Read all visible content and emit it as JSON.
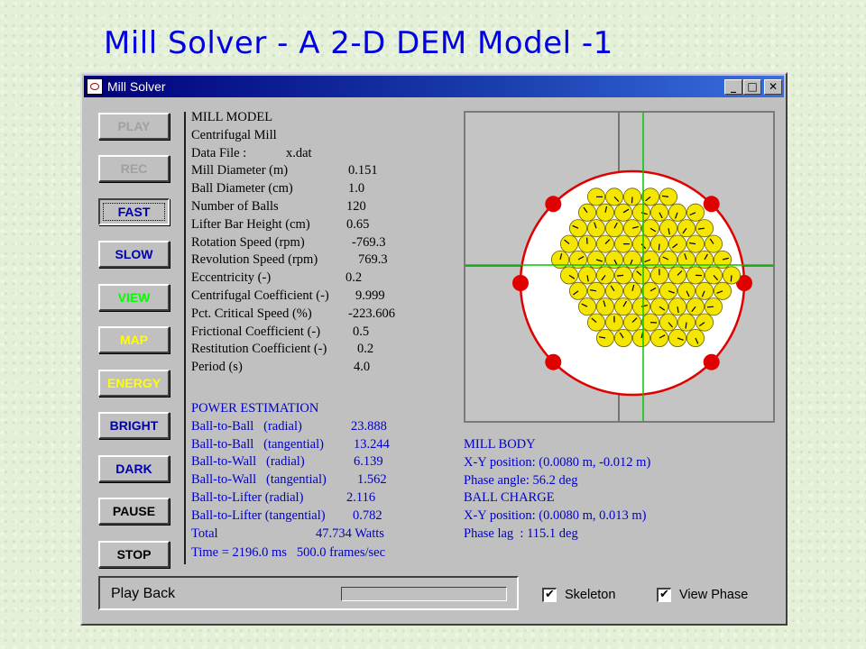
{
  "slide_title": "Mill Solver - A 2-D DEM Model -1",
  "window": {
    "title": "Mill Solver",
    "controls": {
      "minimize": "_",
      "maximize": "□",
      "close": "✕"
    }
  },
  "buttons": [
    {
      "label": "PLAY",
      "color": "#a0a0a0",
      "state": "disabled"
    },
    {
      "label": "REC",
      "color": "#a0a0a0",
      "state": "disabled"
    },
    {
      "label": "FAST",
      "color": "#0000a8",
      "state": "pressed"
    },
    {
      "label": "SLOW",
      "color": "#0000a8",
      "state": "normal"
    },
    {
      "label": "VIEW",
      "color": "#00ff00",
      "state": "normal"
    },
    {
      "label": "MAP",
      "color": "#ffff00",
      "state": "normal"
    },
    {
      "label": "ENERGY",
      "color": "#ffff00",
      "state": "normal"
    },
    {
      "label": "BRIGHT",
      "color": "#0000a8",
      "state": "normal"
    },
    {
      "label": "DARK",
      "color": "#0000a8",
      "state": "normal"
    },
    {
      "label": "PAUSE",
      "color": "#000000",
      "state": "normal"
    },
    {
      "label": "STOP",
      "color": "#000000",
      "state": "normal"
    }
  ],
  "mill_model": {
    "heading": "MILL MODEL",
    "type": "Centrifugal Mill",
    "params": [
      {
        "label": "Data File :",
        "value": "x.dat"
      },
      {
        "label": "Mill Diameter (m)",
        "value": "0.151"
      },
      {
        "label": "Ball Diameter (cm)",
        "value": "1.0"
      },
      {
        "label": "Number of Balls",
        "value": "120"
      },
      {
        "label": "Lifter Bar Height (cm)",
        "value": "0.65"
      },
      {
        "label": "Rotation Speed (rpm)",
        "value": "-769.3"
      },
      {
        "label": "Revolution Speed (rpm)",
        "value": "769.3"
      },
      {
        "label": "Eccentricity (-)",
        "value": "0.2"
      },
      {
        "label": "Centrifugal Coefficient (-)",
        "value": "9.999"
      },
      {
        "label": "Pct. Critical Speed (%)",
        "value": "-223.606"
      },
      {
        "label": "Frictional Coefficient (-)",
        "value": "0.5"
      },
      {
        "label": "Restitution Coefficient (-)",
        "value": "0.2"
      },
      {
        "label": "Period (s)",
        "value": "4.0"
      }
    ]
  },
  "power": {
    "heading": "POWER ESTIMATION",
    "rows": [
      {
        "label": "Ball-to-Ball   (radial)",
        "value": "23.888"
      },
      {
        "label": "Ball-to-Ball   (tangential)",
        "value": "13.244"
      },
      {
        "label": "Ball-to-Wall   (radial)",
        "value": "6.139"
      },
      {
        "label": "Ball-to-Wall   (tangential)",
        "value": "1.562"
      },
      {
        "label": "Ball-to-Lifter (radial)",
        "value": "2.116"
      },
      {
        "label": "Ball-to-Lifter (tangential)",
        "value": "0.782"
      },
      {
        "label": "Total",
        "value": "47.734 Watts"
      }
    ],
    "time_line": "Time = 2196.0 ms   500.0 frames/sec"
  },
  "mill_body": {
    "heading": "MILL BODY",
    "xy": "X-Y position: (0.0080 m, -0.012 m)",
    "phase": "Phase angle: 56.2 deg"
  },
  "ball_charge": {
    "heading": "BALL CHARGE",
    "xy": "X-Y position: (0.0080 m, 0.013 m)",
    "lag": "Phase lag  : 115.1 deg"
  },
  "status": {
    "label": "Play Back",
    "progress": 0
  },
  "checkboxes": [
    {
      "label": "Skeleton",
      "checked": true
    },
    {
      "label": "View Phase",
      "checked": true
    }
  ],
  "colors": {
    "title": "#0000e0",
    "info_blue": "#0000c8",
    "mill_outline": "#e00000",
    "ball_fill": "#f5e600",
    "crosshair": "#00c800"
  }
}
